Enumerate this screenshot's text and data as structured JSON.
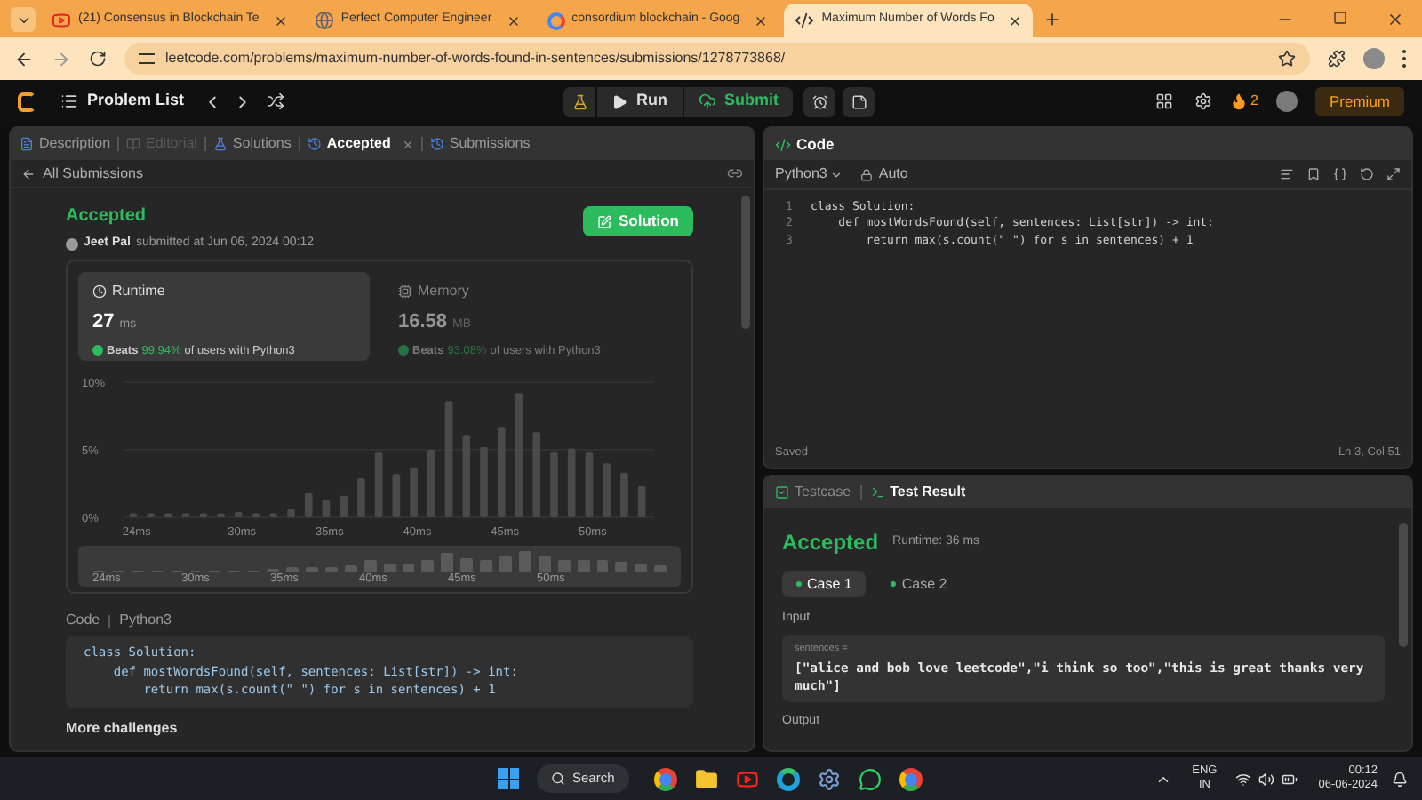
{
  "browser": {
    "tabs": [
      {
        "title": "(21) Consensus in Blockchain Te",
        "selected": false
      },
      {
        "title": "Perfect Computer Engineer",
        "selected": false
      },
      {
        "title": "consordium blockchain - Goog",
        "selected": false
      },
      {
        "title": "Maximum Number of Words Fo",
        "selected": true
      }
    ],
    "url": "leetcode.com/problems/maximum-number-of-words-found-in-sentences/submissions/1278773868/"
  },
  "navbar": {
    "problem_list": "Problem List",
    "run": "Run",
    "submit": "Submit",
    "streak": "2",
    "premium": "Premium"
  },
  "left_panel": {
    "tabs": [
      {
        "label": "Description",
        "selected": false,
        "disabled": false,
        "closable": false
      },
      {
        "label": "Editorial",
        "selected": false,
        "disabled": true,
        "closable": false
      },
      {
        "label": "Solutions",
        "selected": false,
        "disabled": false,
        "closable": false
      },
      {
        "label": "Accepted",
        "selected": true,
        "disabled": false,
        "closable": true
      },
      {
        "label": "Submissions",
        "selected": false,
        "disabled": false,
        "closable": false
      }
    ],
    "back_link": "All Submissions",
    "submission": {
      "status": "Accepted",
      "author": "Jeet Pal",
      "submitted": "submitted at Jun 06, 2024 00:12",
      "solution_button": "Solution"
    },
    "stats": [
      {
        "label": "Runtime",
        "value": "27",
        "unit": "ms",
        "beats": "Beats",
        "percent": "99.94%",
        "suffix": "of users with Python3",
        "selected": true
      },
      {
        "label": "Memory",
        "value": "16.58",
        "unit": "MB",
        "beats": "Beats",
        "percent": "93.08%",
        "suffix": "of users with Python3",
        "selected": false
      }
    ],
    "chart_data": {
      "type": "bar",
      "x": [
        24,
        25,
        26,
        27,
        28,
        29,
        30,
        31,
        32,
        33,
        34,
        35,
        36,
        37,
        38,
        39,
        40,
        41,
        42,
        43,
        44,
        45,
        46,
        47,
        48,
        49,
        50,
        51,
        52,
        53
      ],
      "values": [
        0.3,
        0.3,
        0.3,
        0.3,
        0.3,
        0.3,
        0.4,
        0.3,
        0.3,
        0.6,
        1.8,
        1.3,
        1.6,
        2.9,
        4.8,
        3.2,
        3.7,
        5.0,
        8.6,
        6.1,
        5.2,
        6.7,
        9.2,
        6.3,
        4.8,
        5.1,
        4.8,
        4.0,
        3.3,
        2.3
      ],
      "xlim": [
        23.5,
        53.5
      ],
      "ylim": [
        0,
        10
      ],
      "yticks": [
        {
          "value": 0,
          "label": "0%"
        },
        {
          "value": 5,
          "label": "5%"
        },
        {
          "value": 10,
          "label": "10%"
        }
      ],
      "xticks": [
        {
          "value": 24,
          "label": "24ms"
        },
        {
          "value": 30,
          "label": "30ms"
        },
        {
          "value": 35,
          "label": "35ms"
        },
        {
          "value": 40,
          "label": "40ms"
        },
        {
          "value": 45,
          "label": "45ms"
        },
        {
          "value": 50,
          "label": "50ms"
        }
      ]
    },
    "overview_labels": [
      "24ms",
      "30ms",
      "35ms",
      "40ms",
      "45ms",
      "50ms"
    ],
    "code": {
      "label": "Code",
      "language": "Python3",
      "lines": [
        "class Solution:",
        "    def mostWordsFound(self, sentences: List[str]) -> int:",
        "        return max(s.count(\" \") for s in sentences) + 1"
      ]
    },
    "more": "More challenges"
  },
  "editor": {
    "title": "Code",
    "language": "Python3",
    "mode": "Auto",
    "lines": [
      {
        "number": "1",
        "text": "class Solution:"
      },
      {
        "number": "2",
        "text": "    def mostWordsFound(self, sentences: List[str]) -> int:"
      },
      {
        "number": "3",
        "text": "        return max(s.count(\" \") for s in sentences) + 1"
      }
    ],
    "status": "Saved",
    "cursor": "Ln 3, Col 51"
  },
  "test_panel": {
    "tabs": [
      {
        "label": "Testcase",
        "selected": false
      },
      {
        "label": "Test Result",
        "selected": true
      }
    ],
    "status": "Accepted",
    "runtime": "Runtime: 36 ms",
    "cases": [
      {
        "label": "Case 1",
        "selected": true
      },
      {
        "label": "Case 2",
        "selected": false
      }
    ],
    "input_label": "Input",
    "param": "sentences =",
    "value": "[\"alice and bob love leetcode\",\"i think so too\",\"this is great thanks very much\"]",
    "output_label": "Output"
  },
  "taskbar": {
    "search": "Search",
    "language": "ENG",
    "region": "IN",
    "time": "00:12",
    "date": "06-06-2024"
  }
}
